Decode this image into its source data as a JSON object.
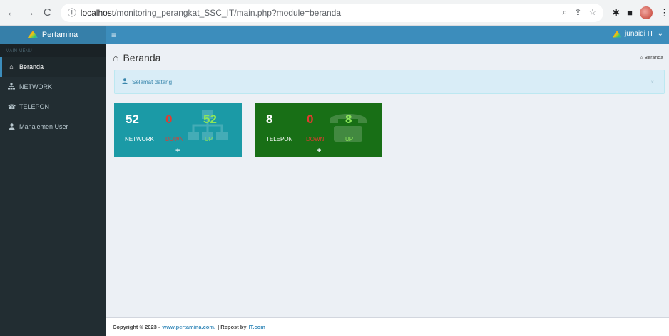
{
  "browser": {
    "back_icon": "←",
    "forward_icon": "→",
    "reload_icon": "C",
    "info_icon": "ⓘ",
    "url_host": "localhost",
    "url_path": "/monitoring_perangkat_SSC_IT/main.php?module=beranda"
  },
  "sidebar": {
    "brand": "Pertamina",
    "menu_header": "MAIN MENU",
    "items": [
      {
        "label": "Beranda",
        "icon": "home-icon"
      },
      {
        "label": "NETWORK",
        "icon": "sitemap-icon"
      },
      {
        "label": "TELEPON",
        "icon": "phone-icon"
      },
      {
        "label": "Manajemen User",
        "icon": "user-icon"
      }
    ]
  },
  "topbar": {
    "menu_icon": "≡",
    "user_name": "junaidi IT",
    "dropdown_caret": "⌄"
  },
  "page": {
    "title": "Beranda",
    "breadcrumb": "Beranda",
    "callout_text": "Selamat datang",
    "callout_close": "×"
  },
  "cards": {
    "network": {
      "total": "52",
      "down": "0",
      "up": "52",
      "label": "NETWORK",
      "down_label": "DOWN",
      "up_label": "UP",
      "more": "+"
    },
    "telepon": {
      "total": "8",
      "down": "0",
      "up": "8",
      "label": "TELEPON",
      "down_label": "DOWN",
      "up_label": "UP",
      "more": "+"
    }
  },
  "footer": {
    "copyright": "Copyright © 2023 -",
    "site_link": "www.pertamina.com.",
    "repost": "| Repost by",
    "repost_link": "IT.com"
  },
  "colors": {
    "sidebar_bg": "#222d32",
    "topbar_bg": "#3c8dbc",
    "network_card": "#1b9aa6",
    "telepon_card": "#186f16",
    "down_red": "#e33a2f",
    "up_green": "#8ce55a"
  }
}
